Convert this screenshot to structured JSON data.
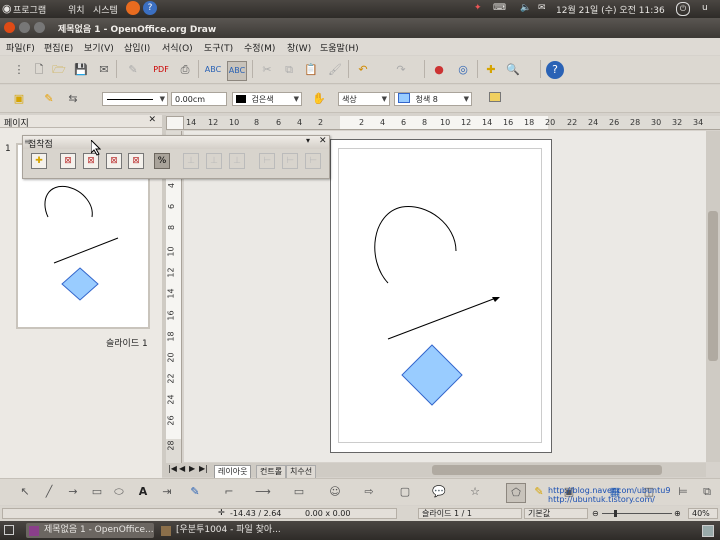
{
  "top_panel": {
    "menus": [
      "프로그램",
      "위치",
      "시스템"
    ],
    "clock": "12월 21일 (수) 오전 11:36",
    "user": "u"
  },
  "window": {
    "title": "제목없음 1 - OpenOffice.org Draw"
  },
  "menubar": [
    "파일(F)",
    "편집(E)",
    "보기(V)",
    "삽입(I)",
    "서식(O)",
    "도구(T)",
    "수정(M)",
    "창(W)",
    "도움말(H)"
  ],
  "standard_toolbar": {
    "icons": [
      "new-icon",
      "open-icon",
      "save-icon",
      "email-icon",
      "edit-file-icon",
      "export-pdf-icon",
      "print-icon",
      "spellcheck-icon",
      "autospellcheck-icon",
      "cut-icon",
      "copy-icon",
      "paste-icon",
      "clone-format-icon",
      "undo-icon",
      "redo-icon",
      "chart-icon",
      "navigator-icon",
      "zoom-icon",
      "help-icon"
    ]
  },
  "line_fill_toolbar": {
    "line_width": "0.00cm",
    "line_color": "검은색",
    "line_color_hex": "#000000",
    "area_style": "색상",
    "area_color": "청색 8",
    "area_color_hex": "#99ccff"
  },
  "slide_pane": {
    "title": "페이지",
    "slide_number": "1",
    "slide_label": "슬라이드 1"
  },
  "glue_toolbar": {
    "title": "접착점"
  },
  "rulers": {
    "horizontal_ticks": [
      "14",
      "12",
      "10",
      "8",
      "6",
      "4",
      "2",
      "2",
      "4",
      "6",
      "8",
      "10",
      "12",
      "14",
      "16",
      "18",
      "20",
      "22",
      "24",
      "26",
      "28",
      "30",
      "32",
      "34"
    ],
    "vertical_ticks": [
      "4",
      "6",
      "8",
      "10",
      "12",
      "14",
      "16",
      "18",
      "20",
      "22",
      "24",
      "26",
      "28"
    ]
  },
  "tabs": [
    "레이아웃",
    "컨트롤",
    "치수선"
  ],
  "status": {
    "position": "-14.43 / 2.64",
    "size": "0.00 x 0.00",
    "slide": "슬라이드 1 / 1",
    "layout": "기본값",
    "zoom": "40%"
  },
  "overlay_text": {
    "line1": "http://blog.naver.com/ubuntu9",
    "line2": "http://ubuntuk.tistory.com/"
  },
  "taskbar": {
    "items": [
      "제목없음 1 - OpenOffice...",
      "[우분투1004 - 파일 찾아..."
    ]
  },
  "colors": {
    "shape_fill": "#99ccff",
    "shape_stroke": "#3366cc",
    "accent_red": "#b33333"
  }
}
